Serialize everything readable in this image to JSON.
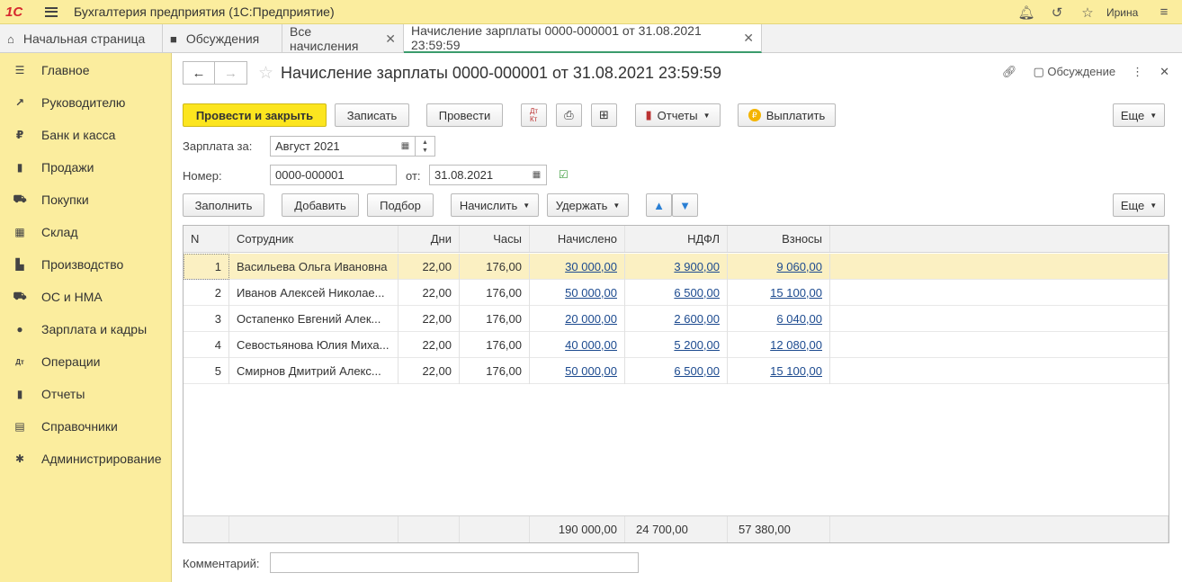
{
  "app": {
    "logo": "1С",
    "title": "Бухгалтерия предприятия  (1С:Предприятие)",
    "user": "Ирина"
  },
  "tabs": [
    {
      "label": "Начальная страница"
    },
    {
      "label": "Обсуждения"
    },
    {
      "label": "Все начисления"
    },
    {
      "label": "Начисление зарплаты 0000-000001 от 31.08.2021 23:59:59"
    }
  ],
  "sidebar": {
    "items": [
      {
        "label": "Главное",
        "icon": "menu-icon"
      },
      {
        "label": "Руководителю",
        "icon": "trend-icon"
      },
      {
        "label": "Банк и касса",
        "icon": "ruble-icon"
      },
      {
        "label": "Продажи",
        "icon": "bag-icon"
      },
      {
        "label": "Покупки",
        "icon": "cart-icon"
      },
      {
        "label": "Склад",
        "icon": "warehouse-icon"
      },
      {
        "label": "Производство",
        "icon": "factory-icon"
      },
      {
        "label": "ОС и НМА",
        "icon": "truck-icon"
      },
      {
        "label": "Зарплата и кадры",
        "icon": "person-icon"
      },
      {
        "label": "Операции",
        "icon": "dt-kt-icon"
      },
      {
        "label": "Отчеты",
        "icon": "bar-chart-icon"
      },
      {
        "label": "Справочники",
        "icon": "book-icon"
      },
      {
        "label": "Администрирование",
        "icon": "gear-icon"
      }
    ]
  },
  "doc": {
    "title": "Начисление зарплаты 0000-000001 от 31.08.2021 23:59:59",
    "discussion": "Обсуждение"
  },
  "toolbar": {
    "post_close": "Провести и закрыть",
    "save": "Записать",
    "post": "Провести",
    "reports": "Отчеты",
    "pay": "Выплатить",
    "more": "Еще"
  },
  "form": {
    "salary_label": "Зарплата за:",
    "salary_value": "Август 2021",
    "number_label": "Номер:",
    "number_value": "0000-000001",
    "date_label": "от:",
    "date_value": "31.08.2021",
    "comment_label": "Комментарий:",
    "comment_value": ""
  },
  "tabletoolbar": {
    "fill": "Заполнить",
    "add": "Добавить",
    "select": "Подбор",
    "accrue": "Начислить",
    "withhold": "Удержать",
    "more": "Еще"
  },
  "table": {
    "headers": [
      "N",
      "Сотрудник",
      "Дни",
      "Часы",
      "Начислено",
      "НДФЛ",
      "Взносы"
    ],
    "rows": [
      {
        "n": "1",
        "employee": "Васильева Ольга Ивановна",
        "days": "22,00",
        "hours": "176,00",
        "accrued": "30 000,00",
        "ndfl": "3 900,00",
        "contrib": "9 060,00"
      },
      {
        "n": "2",
        "employee": "Иванов Алексей Николае...",
        "days": "22,00",
        "hours": "176,00",
        "accrued": "50 000,00",
        "ndfl": "6 500,00",
        "contrib": "15 100,00"
      },
      {
        "n": "3",
        "employee": "Остапенко Евгений Алек...",
        "days": "22,00",
        "hours": "176,00",
        "accrued": "20 000,00",
        "ndfl": "2 600,00",
        "contrib": "6 040,00"
      },
      {
        "n": "4",
        "employee": "Севостьянова Юлия Миха...",
        "days": "22,00",
        "hours": "176,00",
        "accrued": "40 000,00",
        "ndfl": "5 200,00",
        "contrib": "12 080,00"
      },
      {
        "n": "5",
        "employee": "Смирнов Дмитрий Алекс...",
        "days": "22,00",
        "hours": "176,00",
        "accrued": "50 000,00",
        "ndfl": "6 500,00",
        "contrib": "15 100,00"
      }
    ],
    "totals": {
      "accrued": "190 000,00",
      "ndfl": "24 700,00",
      "contrib": "57 380,00"
    }
  }
}
